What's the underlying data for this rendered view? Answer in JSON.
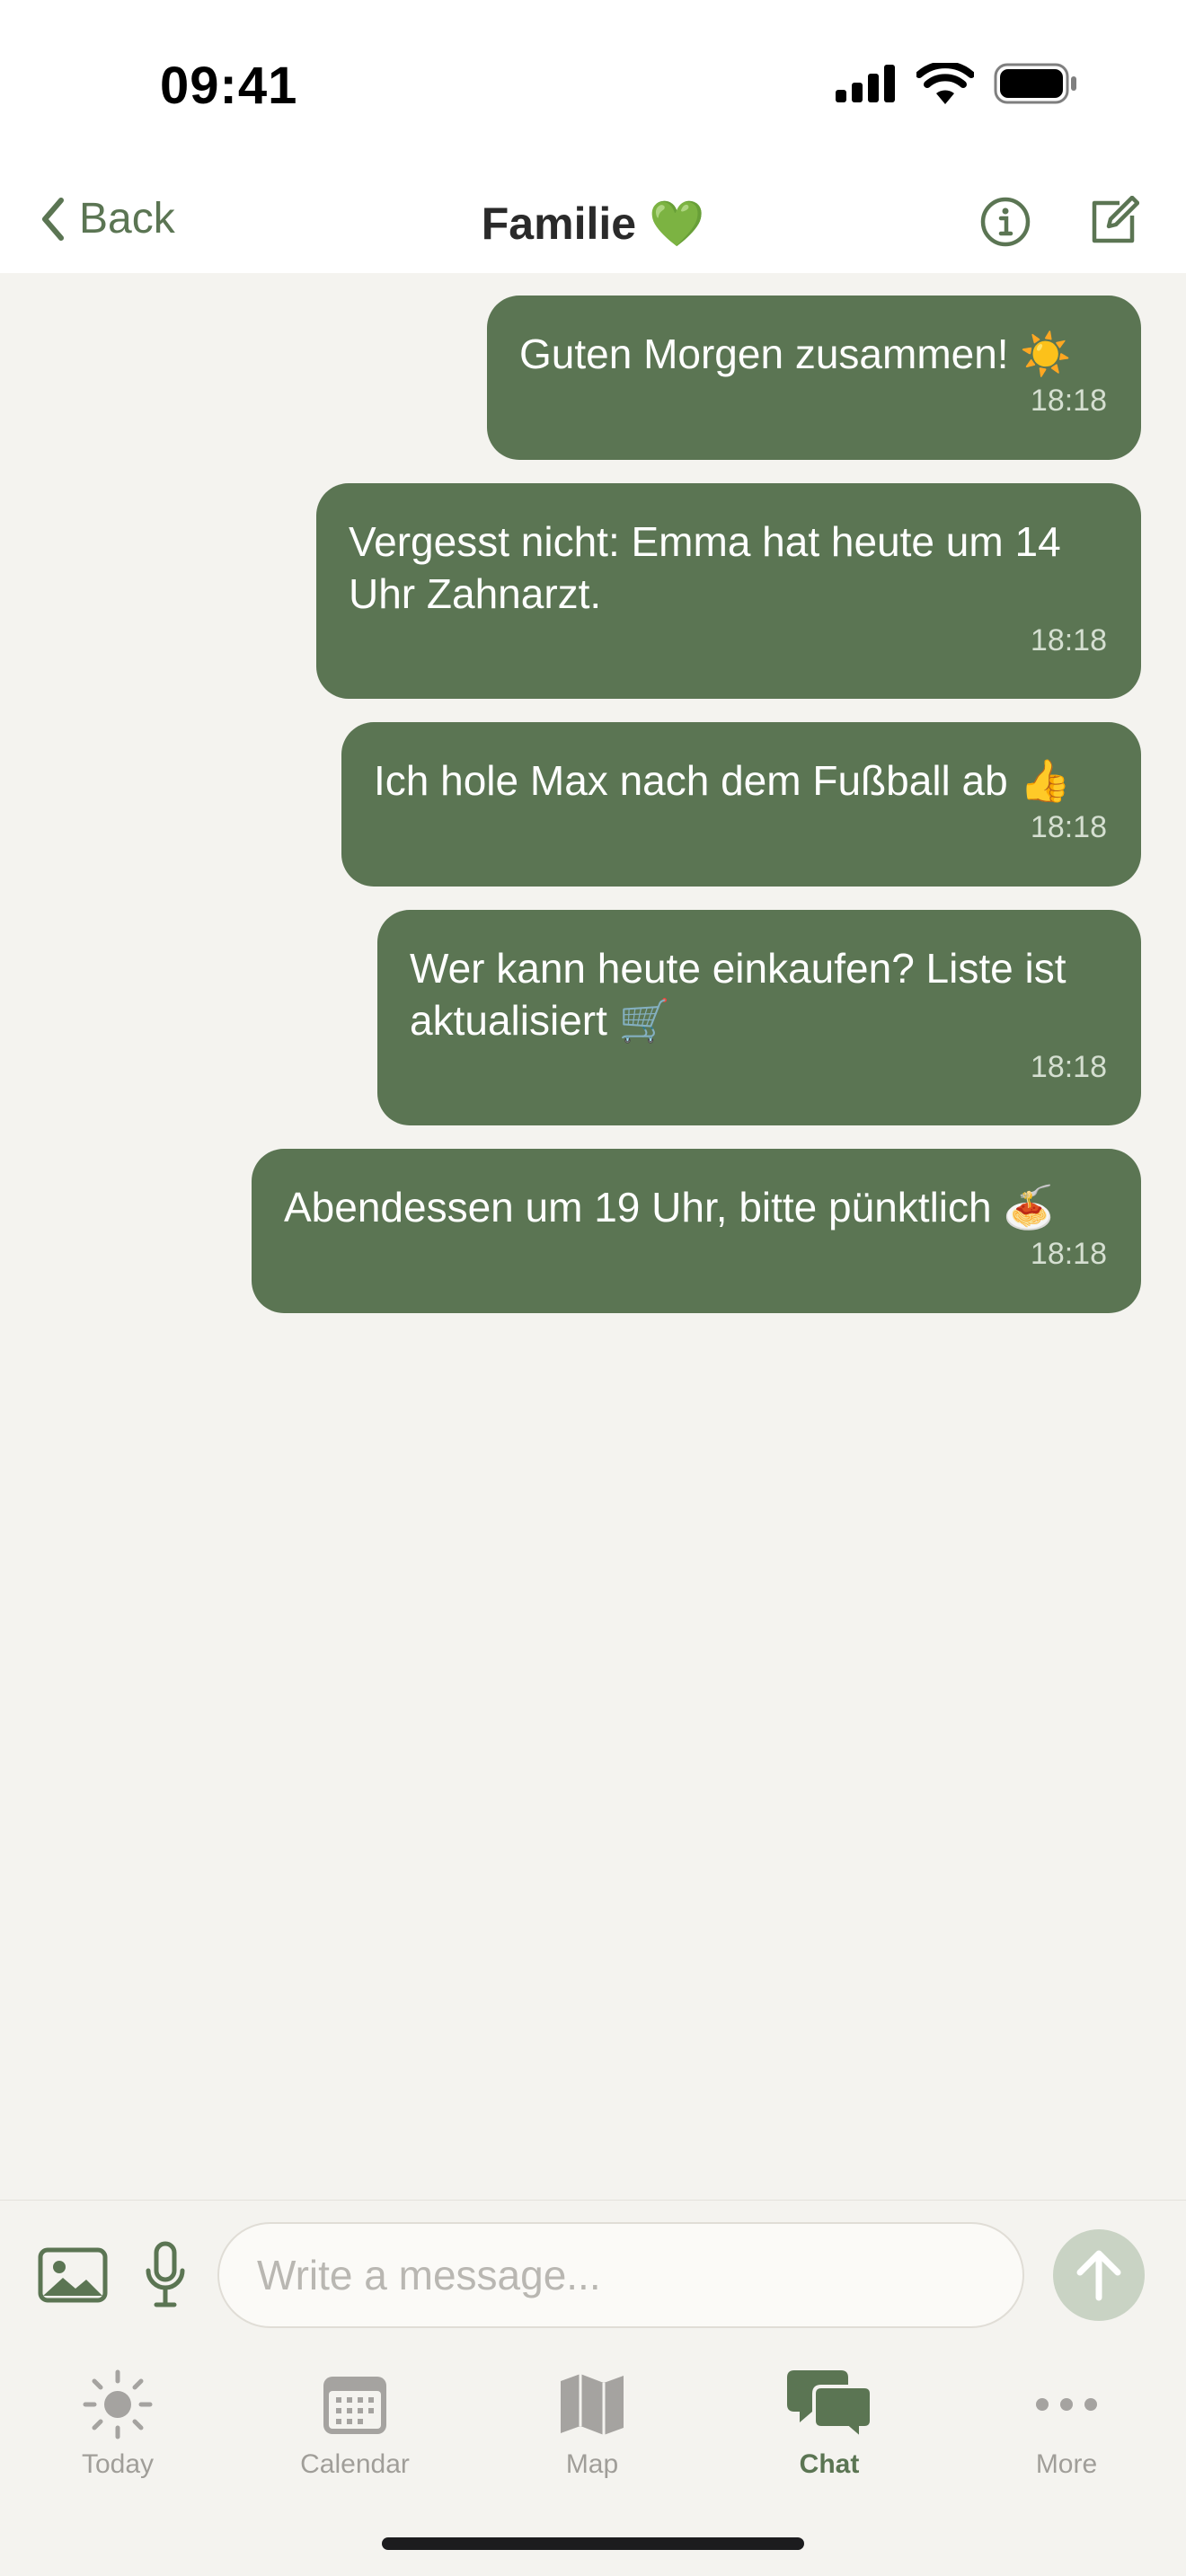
{
  "status_bar": {
    "time": "09:41"
  },
  "nav": {
    "back_label": "Back",
    "title": "Familie",
    "title_emoji": "💚"
  },
  "messages": [
    {
      "text": "Guten Morgen zusammen! ☀️",
      "time": "18:18"
    },
    {
      "text": "Vergesst nicht: Emma hat heute um 14 Uhr Zahnarzt.",
      "time": "18:18"
    },
    {
      "text": "Ich hole Max nach dem Fußball ab 👍",
      "time": "18:18"
    },
    {
      "text": "Wer kann heute einkaufen? Liste ist aktualisiert 🛒",
      "time": "18:18"
    },
    {
      "text": "Abendessen um 19 Uhr, bitte pünktlich 🍝",
      "time": "18:18"
    }
  ],
  "composer": {
    "placeholder": "Write a message..."
  },
  "tabs": [
    {
      "label": "Today",
      "icon": "sun-icon"
    },
    {
      "label": "Calendar",
      "icon": "calendar-icon"
    },
    {
      "label": "Map",
      "icon": "map-icon"
    },
    {
      "label": "Chat",
      "icon": "chat-icon",
      "active": true
    },
    {
      "label": "More",
      "icon": "more-icon"
    }
  ],
  "colors": {
    "accent": "#5B7553",
    "background": "#F4F3EF",
    "bubble_text": "#FFFFFF",
    "send_disabled": "#C9D3C4"
  }
}
